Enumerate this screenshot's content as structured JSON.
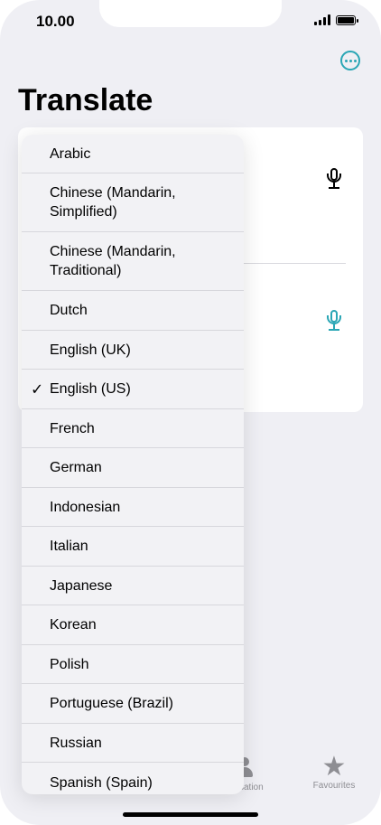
{
  "status_bar": {
    "time": "10.00"
  },
  "header": {
    "title": "Translate"
  },
  "tab_bar": {
    "conversation_label_partial": "sation",
    "favourites_label": "Favourites"
  },
  "language_menu": {
    "selected": "English (US)",
    "items": [
      {
        "label": "Arabic"
      },
      {
        "label": "Chinese (Mandarin, Simplified)"
      },
      {
        "label": "Chinese (Mandarin, Traditional)"
      },
      {
        "label": "Dutch"
      },
      {
        "label": "English (UK)"
      },
      {
        "label": "English (US)",
        "checked": true
      },
      {
        "label": "French"
      },
      {
        "label": "German"
      },
      {
        "label": "Indonesian"
      },
      {
        "label": "Italian"
      },
      {
        "label": "Japanese"
      },
      {
        "label": "Korean"
      },
      {
        "label": "Polish"
      },
      {
        "label": "Portuguese (Brazil)"
      },
      {
        "label": "Russian"
      },
      {
        "label": "Spanish (Spain)"
      }
    ]
  },
  "colors": {
    "accent": "#2aa6b5",
    "background": "#efeff4",
    "menu_background": "#f2f2f5"
  }
}
